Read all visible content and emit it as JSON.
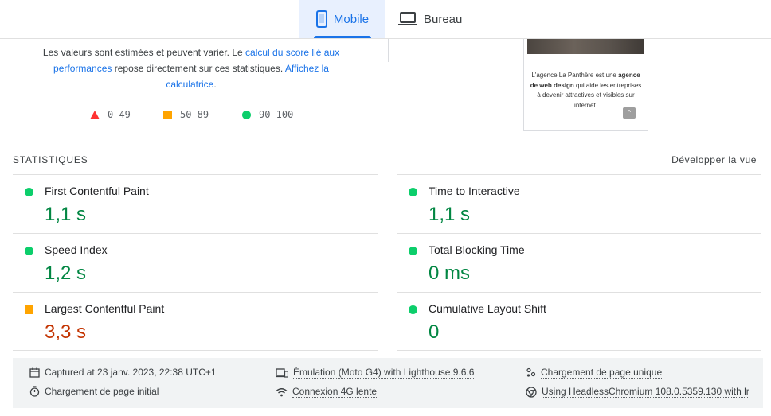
{
  "tabs": {
    "mobile_label": "Mobile",
    "desktop_label": "Bureau",
    "active": "Mobile",
    "mobile_icon": "smartphone-icon",
    "desktop_icon": "laptop-icon"
  },
  "score_note": {
    "text_1": "Les valeurs sont estimées et peuvent varier. Le ",
    "link_1": "calcul du score lié aux performances",
    "text_2": " repose directement sur ces statistiques. ",
    "link_2": "Affichez la calculatrice",
    "text_3": "."
  },
  "legend": {
    "fail": "0–49",
    "average": "50–89",
    "pass": "90–100"
  },
  "thumbnail": {
    "text_before": "L'agence La Panthère est une ",
    "text_bold": "agence de web design",
    "text_after": " qui aide les entreprises à devenir attractives et visibles sur internet.",
    "up_arrow": "^"
  },
  "statistics": {
    "title": "STATISTIQUES",
    "expand_label": "Développer la vue",
    "metrics": [
      {
        "name": "First Contentful Paint",
        "value": "1,1 s",
        "status": "pass"
      },
      {
        "name": "Time to Interactive",
        "value": "1,1 s",
        "status": "pass"
      },
      {
        "name": "Speed Index",
        "value": "1,2 s",
        "status": "pass"
      },
      {
        "name": "Total Blocking Time",
        "value": "0 ms",
        "status": "pass"
      },
      {
        "name": "Largest Contentful Paint",
        "value": "3,3 s",
        "status": "average"
      },
      {
        "name": "Cumulative Layout Shift",
        "value": "0",
        "status": "pass"
      }
    ]
  },
  "runtime": {
    "captured": "Captured at 23 janv. 2023, 22:38 UTC+1",
    "initial_load": "Chargement de page initial",
    "emulation": "Émulation (Moto G4) with Lighthouse 9.6.6",
    "network": "Connexion 4G lente",
    "single_load": "Chargement de page unique",
    "browser": "Using HeadlessChromium 108.0.5359.130 with lr"
  },
  "colors": {
    "accent": "#1a73e8",
    "pass": "#0cce6b",
    "pass_text": "#018642",
    "average": "#ffa400",
    "average_text": "#c33300",
    "fail": "#ff3333"
  }
}
